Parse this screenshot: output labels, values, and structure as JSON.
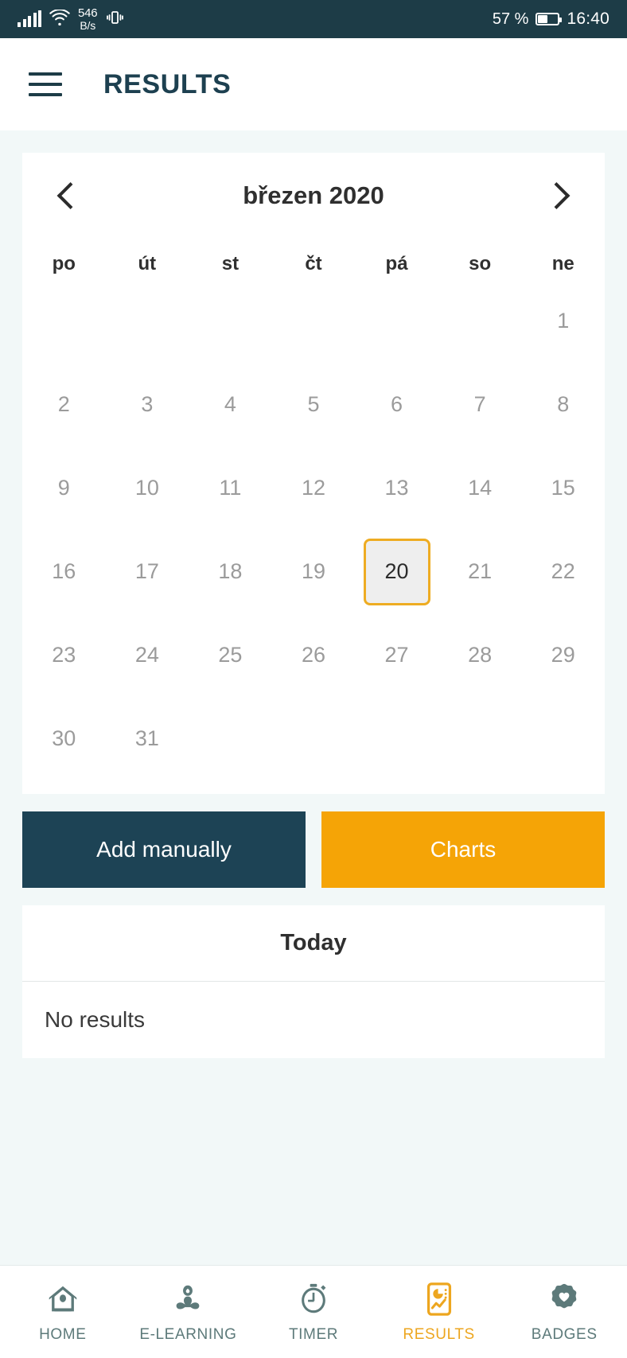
{
  "status_bar": {
    "network_speed_value": "546",
    "network_speed_unit": "B/s",
    "battery_percent": "57 %",
    "time": "16:40",
    "icons": [
      "signal-bars-icon",
      "wifi-icon",
      "vibrate-icon",
      "battery-icon"
    ]
  },
  "header": {
    "menu_icon": "hamburger-menu-icon",
    "title": "RESULTS"
  },
  "calendar": {
    "prev_icon": "chevron-left-icon",
    "next_icon": "chevron-right-icon",
    "month_label": "březen 2020",
    "weekdays": [
      "po",
      "út",
      "st",
      "čt",
      "pá",
      "so",
      "ne"
    ],
    "selected_day": "20",
    "weeks": [
      [
        "",
        "",
        "",
        "",
        "",
        "",
        "1"
      ],
      [
        "2",
        "3",
        "4",
        "5",
        "6",
        "7",
        "8"
      ],
      [
        "9",
        "10",
        "11",
        "12",
        "13",
        "14",
        "15"
      ],
      [
        "16",
        "17",
        "18",
        "19",
        "20",
        "21",
        "22"
      ],
      [
        "23",
        "24",
        "25",
        "26",
        "27",
        "28",
        "29"
      ],
      [
        "30",
        "31",
        "",
        "",
        "",
        "",
        ""
      ]
    ]
  },
  "actions": {
    "add_manually_label": "Add manually",
    "charts_label": "Charts"
  },
  "results": {
    "section_title": "Today",
    "empty_text": "No results"
  },
  "bottom_nav": {
    "items": [
      {
        "label": "HOME",
        "icon": "home-icon",
        "active": false
      },
      {
        "label": "E-LEARNING",
        "icon": "meditation-icon",
        "active": false
      },
      {
        "label": "TIMER",
        "icon": "stopwatch-icon",
        "active": false
      },
      {
        "label": "RESULTS",
        "icon": "results-chart-icon",
        "active": true
      },
      {
        "label": "BADGES",
        "icon": "badge-heart-icon",
        "active": false
      }
    ]
  },
  "colors": {
    "status_bar_bg": "#1d3c47",
    "header_text": "#1d4050",
    "page_bg": "#f2f8f8",
    "accent_orange": "#f5a406",
    "dark_button": "#1d4355",
    "nav_inactive": "#5d7a7a",
    "nav_active": "#eda61f",
    "selected_border": "#eeac22"
  }
}
